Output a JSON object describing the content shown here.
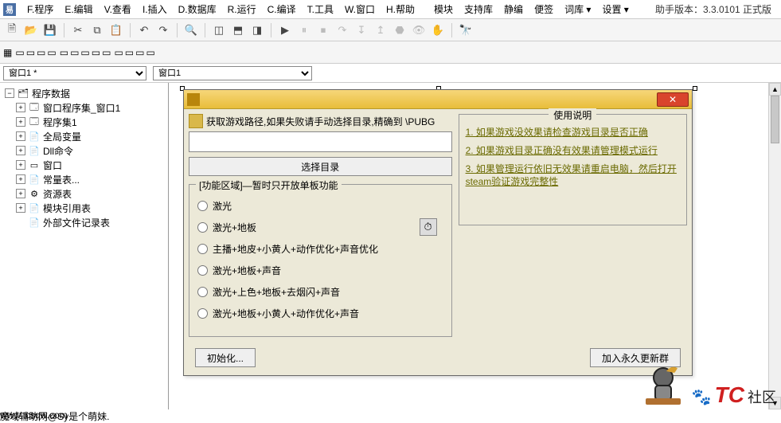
{
  "app": {
    "version_label": "助手版本：3.3.0101 正式版"
  },
  "menu": {
    "items": [
      "F.程序",
      "E.编辑",
      "V.查看",
      "I.插入",
      "D.数据库",
      "R.运行",
      "C.编译",
      "T.工具",
      "W.窗口",
      "H.帮助"
    ],
    "extra": [
      "模块",
      "支持库",
      "静编",
      "便签",
      "词库 ▾",
      "设置 ▾"
    ]
  },
  "tabs": {
    "combo1": "窗口1 *",
    "combo2": "窗口1"
  },
  "tree": {
    "root": "程序数据",
    "items": [
      {
        "icon": "🗔",
        "label": "窗口程序集_窗口1",
        "exp": "+"
      },
      {
        "icon": "🗔",
        "label": "程序集1",
        "exp": "+"
      },
      {
        "icon": "📄",
        "label": "全局变量",
        "exp": "+"
      },
      {
        "icon": "📄",
        "label": "Dll命令",
        "exp": "+"
      },
      {
        "icon": "▭",
        "label": "窗口",
        "exp": "+"
      },
      {
        "icon": "📄",
        "label": "常量表...",
        "exp": "+"
      },
      {
        "icon": "⚙",
        "label": "资源表",
        "exp": "+"
      },
      {
        "icon": "📄",
        "label": "模块引用表",
        "exp": "+"
      },
      {
        "icon": "📄",
        "label": "外部文件记录表",
        "exp": ""
      }
    ]
  },
  "dialog": {
    "path_hint": "获取游戏路径,如果失败请手动选择目录,精确到 \\PUBG",
    "path_value": "",
    "select_dir_btn": "选择目录",
    "fieldset_title": "[功能区域]—暂时只开放单板功能",
    "radios": [
      "激光",
      "激光+地板",
      "主播+地皮+小黄人+动作优化+声音优化",
      "激光+地板+声音",
      "激光+上色+地板+去烟闪+声音",
      "激光+地板+小黄人+动作优化+声音"
    ],
    "init_btn": "初始化...",
    "join_btn": "加入永久更新群",
    "instructions_title": "使用说明",
    "instructions": [
      "1. 如果游戏没效果请检查游戏目录是否正确",
      "2. 如果游戏目录正确没有效果请管理模式运行",
      "3. 如果管理运行依旧无效果请重启电脑，然后打开steam验证游戏完整性"
    ]
  },
  "watermark": {
    "brand_big": "TC",
    "brand_small": "社区",
    "url": "www.tcsqw.com",
    "sub": "魔域辅助网@Sy是个萌妹."
  }
}
